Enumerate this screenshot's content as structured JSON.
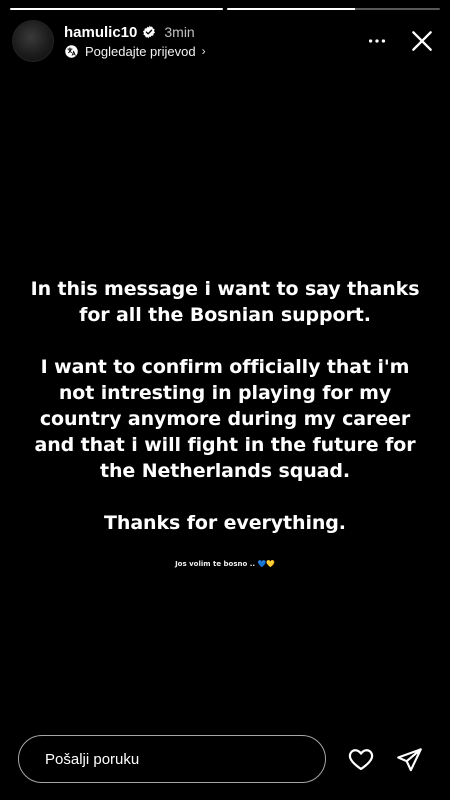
{
  "progress": {
    "segments": 2,
    "current_fill": 1.0
  },
  "header": {
    "username": "hamulic10",
    "time": "3min",
    "translate_label": "Pogledajte prijevod",
    "chevron": "›",
    "verified_color": "#3897f0"
  },
  "message": {
    "line1": "In this message i want to say thanks for all the Bosnian support.",
    "line2": "I want to confirm officially that i'm not intresting in playing for my country anymore during my career and that i will fight in the future for the Netherlands squad.",
    "line3": "Thanks for everything.",
    "note": "Jos volim te bosno ..",
    "note_hearts": [
      "💙",
      "💛"
    ]
  },
  "footer": {
    "reply_placeholder": "Pošalji poruku"
  },
  "icons": {
    "more": "more-options-icon",
    "close": "close-icon",
    "heart": "heart-icon",
    "send": "send-icon",
    "translate": "translate-icon"
  }
}
